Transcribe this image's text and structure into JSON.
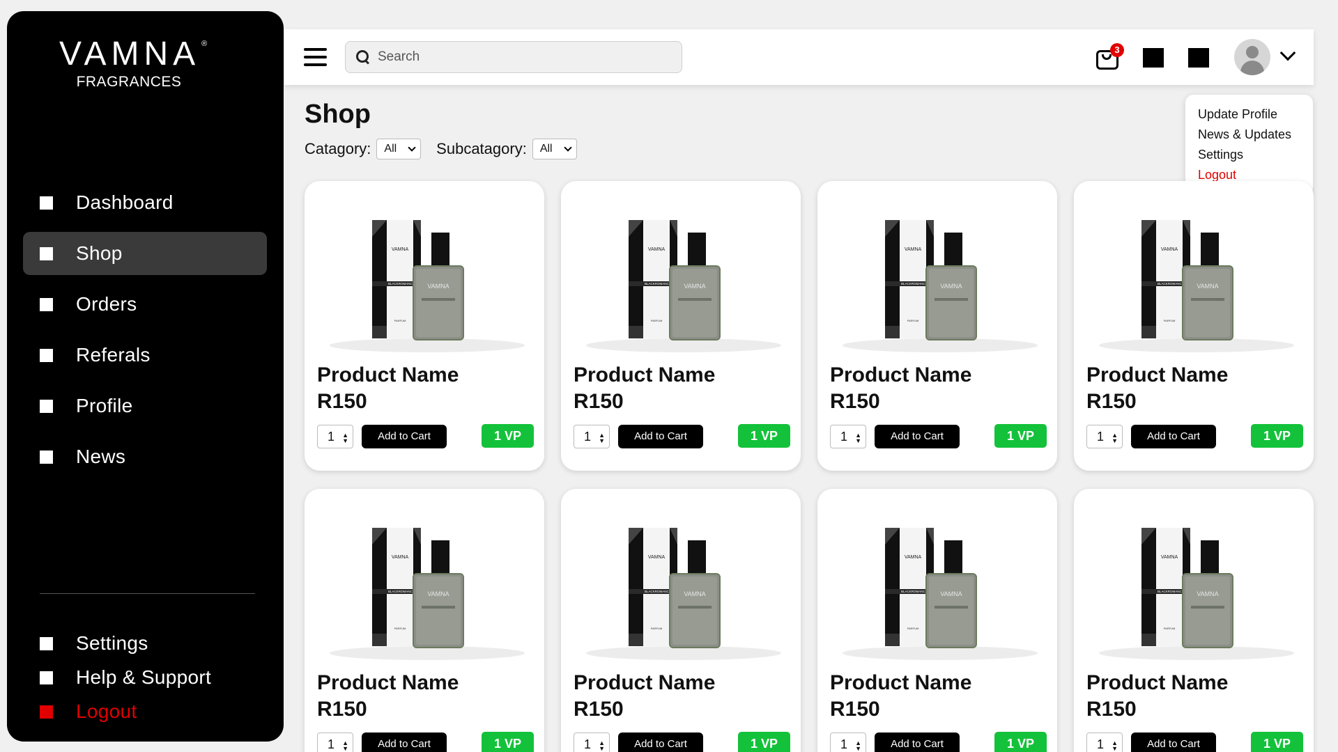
{
  "brand": {
    "name": "VAMNA",
    "reg": "®",
    "sub": "FRAGRANCES"
  },
  "sidebar": {
    "items": [
      {
        "label": "Dashboard"
      },
      {
        "label": "Shop",
        "active": true
      },
      {
        "label": "Orders"
      },
      {
        "label": "Referals"
      },
      {
        "label": "Profile"
      },
      {
        "label": "News"
      }
    ],
    "bottom_items": [
      {
        "label": "Settings"
      },
      {
        "label": "Help & Support"
      },
      {
        "label": "Logout",
        "color": "#e00000"
      }
    ]
  },
  "topbar": {
    "search_placeholder": "Search",
    "cart_count": "3"
  },
  "profile_menu": {
    "items": [
      "Update Profile",
      "News & Updates",
      "Settings",
      "Logout"
    ]
  },
  "page": {
    "title": "Shop",
    "filters": {
      "category_label": "Catagory:",
      "category_value": "All",
      "subcategory_label": "Subcatagory:",
      "subcategory_value": "All"
    }
  },
  "products": [
    {
      "name": "Product Name",
      "price": "R150",
      "qty": "1",
      "add_label": "Add to Cart",
      "vp": "1 VP"
    },
    {
      "name": "Product Name",
      "price": "R150",
      "qty": "1",
      "add_label": "Add to Cart",
      "vp": "1 VP"
    },
    {
      "name": "Product Name",
      "price": "R150",
      "qty": "1",
      "add_label": "Add to Cart",
      "vp": "1 VP"
    },
    {
      "name": "Product Name",
      "price": "R150",
      "qty": "1",
      "add_label": "Add to Cart",
      "vp": "1 VP"
    },
    {
      "name": "Product Name",
      "price": "R150",
      "qty": "1",
      "add_label": "Add to Cart",
      "vp": "1 VP"
    },
    {
      "name": "Product Name",
      "price": "R150",
      "qty": "1",
      "add_label": "Add to Cart",
      "vp": "1 VP"
    },
    {
      "name": "Product Name",
      "price": "R150",
      "qty": "1",
      "add_label": "Add to Cart",
      "vp": "1 VP"
    },
    {
      "name": "Product Name",
      "price": "R150",
      "qty": "1",
      "add_label": "Add to Cart",
      "vp": "1 VP"
    }
  ],
  "product_image": {
    "box_brand": "VAMNA",
    "box_band": "BLACKROMANCE",
    "box_label": "PARFUM",
    "bottle_brand": "VAMNA"
  },
  "colors": {
    "accent_green": "#13c23a",
    "danger_red": "#e00000",
    "sidebar_bg": "#000000",
    "active_item_bg": "#3a3a3a"
  }
}
